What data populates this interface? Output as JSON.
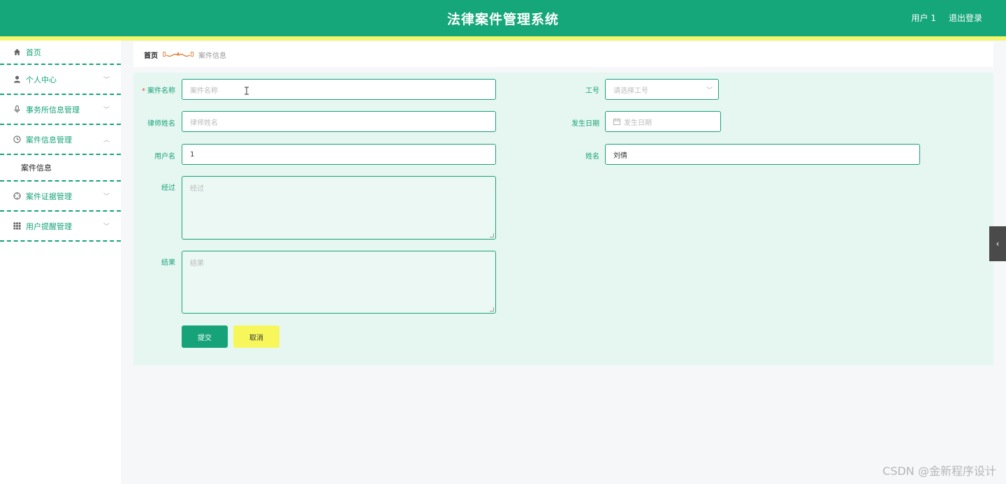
{
  "header": {
    "title": "法律案件管理系统",
    "user": "用户 1",
    "logout": "退出登录"
  },
  "sidebar": {
    "items": [
      {
        "label": "首页",
        "icon": "home-icon"
      },
      {
        "label": "个人中心",
        "icon": "user-icon"
      },
      {
        "label": "事务所信息管理",
        "icon": "mic-icon"
      },
      {
        "label": "案件信息管理",
        "icon": "clock-icon"
      },
      {
        "label": "案件证据管理",
        "icon": "crosshair-icon"
      },
      {
        "label": "用户提醒管理",
        "icon": "grid-icon"
      }
    ],
    "submenu": {
      "label": "案件信息"
    }
  },
  "breadcrumb": {
    "home": "首页",
    "current": "案件信息"
  },
  "form": {
    "case_name": {
      "label": "案件名称",
      "placeholder": "案件名称"
    },
    "job_no": {
      "label": "工号",
      "placeholder": "请选择工号"
    },
    "lawyer_name": {
      "label": "律师姓名",
      "placeholder": "律师姓名"
    },
    "date": {
      "label": "发生日期",
      "placeholder": "发生日期"
    },
    "username": {
      "label": "用户名",
      "value": "1"
    },
    "name": {
      "label": "姓名",
      "value": "刘倩"
    },
    "process": {
      "label": "经过",
      "placeholder": "经过"
    },
    "result": {
      "label": "结果",
      "placeholder": "结果"
    },
    "submit": "提交",
    "cancel": "取消"
  },
  "watermark": "CSDN @金新程序设计"
}
